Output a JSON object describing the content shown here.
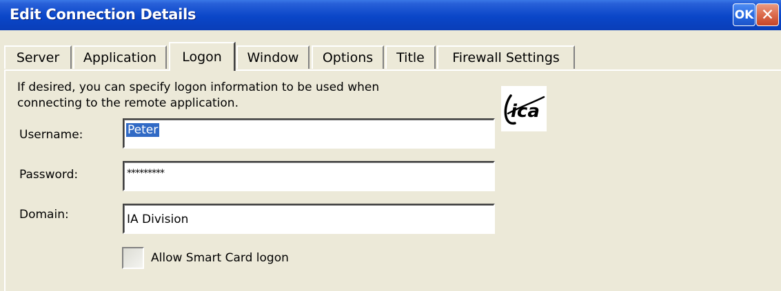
{
  "window": {
    "title": "Edit Connection Details",
    "ok_label": "OK",
    "close_glyph": "✕"
  },
  "tabs": [
    {
      "label": "Server",
      "active": false
    },
    {
      "label": "Application",
      "active": false
    },
    {
      "label": "Logon",
      "active": true
    },
    {
      "label": "Window",
      "active": false
    },
    {
      "label": "Options",
      "active": false
    },
    {
      "label": "Title",
      "active": false
    },
    {
      "label": "Firewall Settings",
      "active": false
    }
  ],
  "logon": {
    "description_line1": "If desired, you can specify logon information to be used when",
    "description_line2": "connecting to the remote application.",
    "username_label": "Username:",
    "username_value": "Peter",
    "password_label": "Password:",
    "password_value": "*********",
    "domain_label": "Domain:",
    "domain_value": "IA Division",
    "smartcard_label": "Allow Smart Card logon",
    "smartcard_checked": false,
    "logo_text": "ica"
  },
  "colors": {
    "titlebar": "#0A46C8",
    "dialog_bg": "#ECE9D8",
    "selection": "#316AC5",
    "close_button": "#DC6B4C"
  }
}
